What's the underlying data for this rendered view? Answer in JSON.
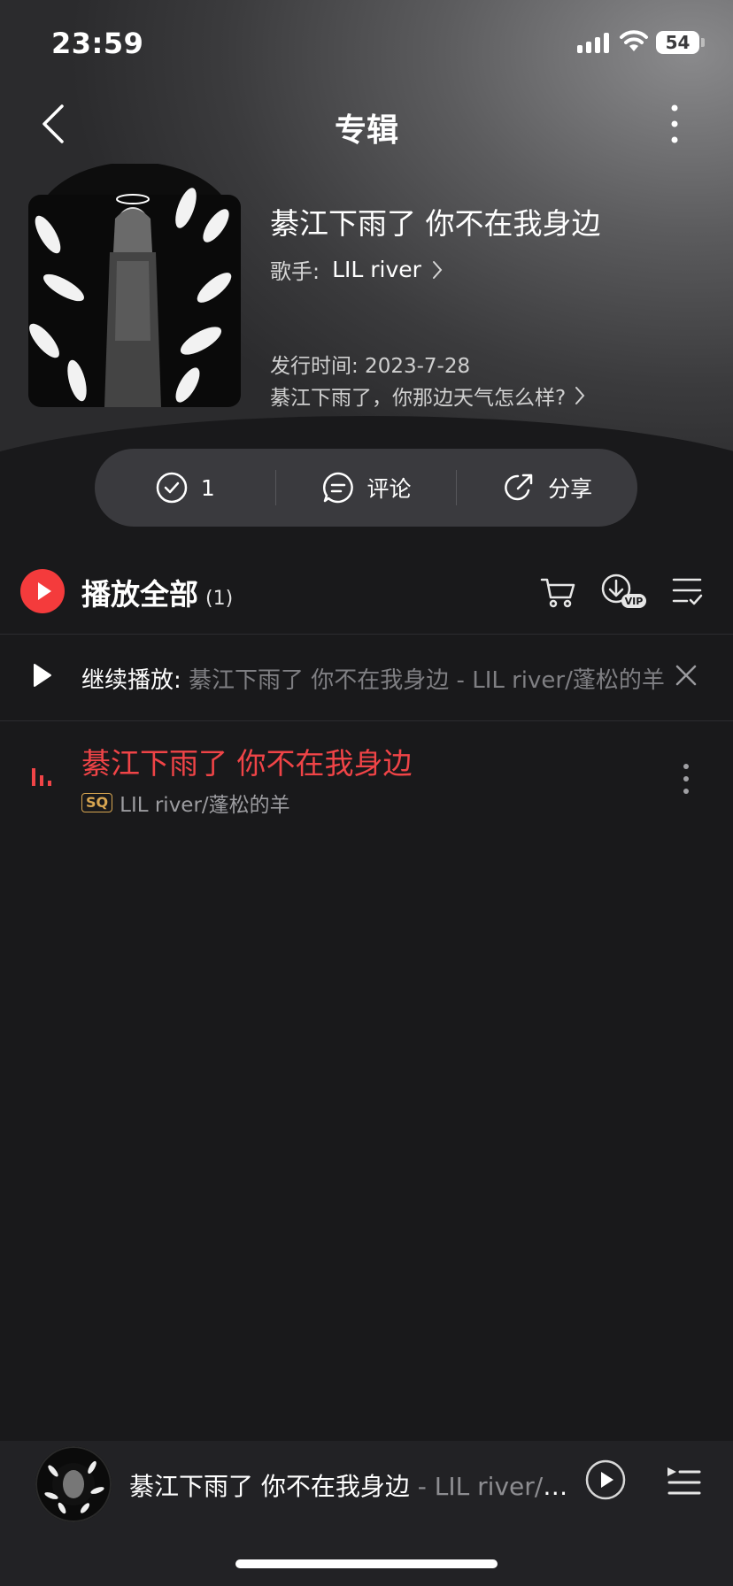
{
  "status_bar": {
    "time": "23:59",
    "battery": "54"
  },
  "nav": {
    "title": "专辑"
  },
  "album": {
    "title": "綦江下雨了 你不在我身边",
    "artist_label": "歌手:",
    "artist_name": "LIL river",
    "release": "发行时间: 2023-7-28",
    "description": "綦江下雨了，你那边天气怎么样?"
  },
  "actions": {
    "collect_count": "1",
    "comment_label": "评论",
    "share_label": "分享"
  },
  "play_all": {
    "label": "播放全部",
    "count": "(1)"
  },
  "continue_bar": {
    "label": "继续播放:",
    "song": " 綦江下雨了 你不在我身边 - LIL river/蓬松的羊"
  },
  "songs": [
    {
      "title": "綦江下雨了 你不在我身边",
      "quality": "SQ",
      "artists": "LIL river/蓬松的羊"
    }
  ],
  "mini_player": {
    "title": "綦江下雨了 你不在我身边",
    "artist": " - LIL river/蓬松的羊"
  },
  "colors": {
    "accent": "#f43b3c",
    "background": "#19191b",
    "sq_badge": "#d8a651"
  }
}
